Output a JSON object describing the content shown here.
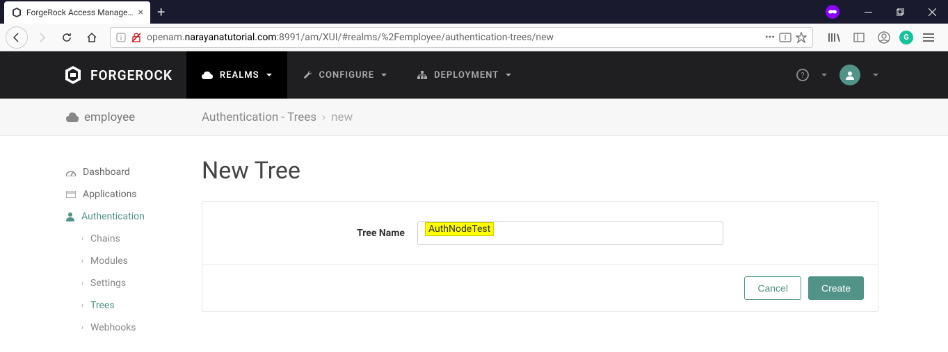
{
  "browser": {
    "tab_title": "ForgeRock Access Managemen",
    "url_prefix": "openam.",
    "url_domain": "narayanatutorial.com",
    "url_suffix": ":8991/am/XUI/#realms/%2Femployee/authentication-trees/new"
  },
  "header": {
    "brand": "FORGEROCK",
    "nav": {
      "realms": "REALMS",
      "configure": "CONFIGURE",
      "deployment": "DEPLOYMENT"
    }
  },
  "breadcrumb": {
    "realm": "employee",
    "path1": "Authentication - Trees",
    "path2": "new"
  },
  "sidebar": {
    "dashboard": "Dashboard",
    "applications": "Applications",
    "authentication": "Authentication",
    "chains": "Chains",
    "modules": "Modules",
    "settings": "Settings",
    "trees": "Trees",
    "webhooks": "Webhooks"
  },
  "page": {
    "title": "New Tree",
    "field_label": "Tree Name",
    "field_value": "AuthNodeTest",
    "cancel": "Cancel",
    "create": "Create"
  }
}
